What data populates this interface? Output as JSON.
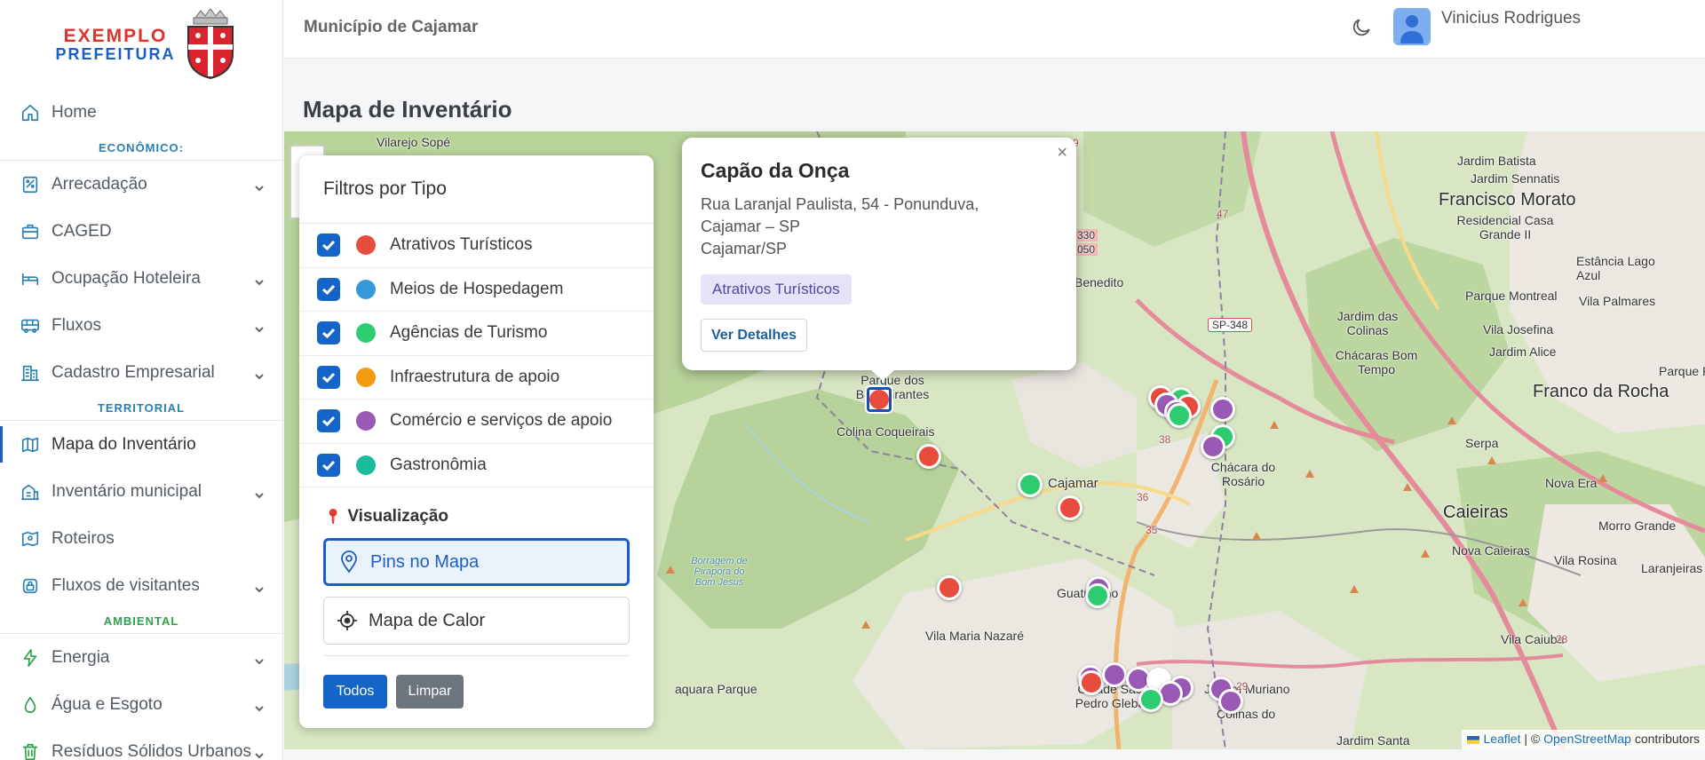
{
  "brand": {
    "line1": "EXEMPLO",
    "line2": "PREFEITURA"
  },
  "sidebar": {
    "home": "Home",
    "sections": {
      "economico": "ECONÔMICO:",
      "territorial": "TERRITORIAL",
      "ambiental": "AMBIENTAL"
    },
    "economico_items": [
      {
        "label": "Arrecadação",
        "icon": "receipt-icon",
        "has_chevron": true
      },
      {
        "label": "CAGED",
        "icon": "briefcase-icon",
        "has_chevron": false
      },
      {
        "label": "Ocupação Hoteleira",
        "icon": "bed-icon",
        "has_chevron": true
      },
      {
        "label": "Fluxos",
        "icon": "bus-icon",
        "has_chevron": true
      },
      {
        "label": "Cadastro Empresarial",
        "icon": "building-icon",
        "has_chevron": true
      }
    ],
    "territorial_items": [
      {
        "label": "Mapa do Inventário",
        "icon": "map-icon",
        "has_chevron": false,
        "active": true
      },
      {
        "label": "Inventário municipal",
        "icon": "city-icon",
        "has_chevron": true
      },
      {
        "label": "Roteiros",
        "icon": "route-icon",
        "has_chevron": false
      },
      {
        "label": "Fluxos de visitantes",
        "icon": "lock-icon",
        "has_chevron": true
      }
    ],
    "ambiental_items": [
      {
        "label": "Energia",
        "icon": "lightning-icon",
        "has_chevron": true
      },
      {
        "label": "Água e Esgoto",
        "icon": "drop-icon",
        "has_chevron": true
      },
      {
        "label": "Resíduos Sólidos Urbanos",
        "icon": "trash-icon",
        "has_chevron": true
      }
    ]
  },
  "header": {
    "title": "Município de Cajamar",
    "user_name": "Vinicius Rodrigues"
  },
  "page": {
    "title": "Mapa de Inventário"
  },
  "filters": {
    "title": "Filtros por Tipo",
    "types": [
      {
        "label": "Atrativos Turísticos",
        "color": "#e74c3c",
        "checked": true
      },
      {
        "label": "Meios de Hospedagem",
        "color": "#3498db",
        "checked": true
      },
      {
        "label": "Agências de Turismo",
        "color": "#2ecc71",
        "checked": true
      },
      {
        "label": "Infraestrutura de apoio",
        "color": "#f39c12",
        "checked": true
      },
      {
        "label": "Comércio e serviços de apoio",
        "color": "#9b59b6",
        "checked": true
      },
      {
        "label": "Gastronômia",
        "color": "#1abc9c",
        "checked": true
      }
    ],
    "visualization_title": "Visualização",
    "pins_label": "Pins no Mapa",
    "heat_label": "Mapa de Calor",
    "all_label": "Todos",
    "clear_label": "Limpar",
    "colors": {
      "primary": "#1565c9",
      "secondary": "#6c757d"
    }
  },
  "popup": {
    "title": "Capão da Onça",
    "address_line1": "Rua Laranjal Paulista, 54 - Ponunduva,",
    "address_line2": "Cajamar – SP",
    "address_line3": "Cajamar/SP",
    "badge": "Atrativos Turísticos",
    "button": "Ver Detalhes",
    "close": "×"
  },
  "map": {
    "labels": [
      "Vilarejo Sopé",
      "Jardim Batista",
      "Jardim Sennatis",
      "Francisco Morato",
      "Residencial Casa Grande II",
      "Estância Lago Azul",
      "Parque Montreal",
      "Vila Palmares",
      "Jardim das Colinas",
      "Vila Josefina",
      "Jardim Alice",
      "Chácaras Bom Tempo",
      "Franco da Rocha",
      "Parque Pretór",
      "Parque dos Bandeirantes",
      "Colina Coqueirais",
      "Chácara do Rosário",
      "Serpa",
      "Nova Era",
      "Caieiras",
      "Morro Grande",
      "Nova Caieiras",
      "Vila Rosina",
      "Laranjeiras",
      "Vila Caiuba",
      "Vila Maria Nazaré",
      "Cidade São Pedro Gleba",
      "Jardim Muriano",
      "Colinas do",
      "Jardim Santa",
      "Borragem de Pirapora do Bom Jesus",
      "Benedito",
      "Guaturinho",
      "Cajamar",
      "aquara Parque"
    ],
    "road_labels": [
      "SP-348",
      "330",
      "050",
      "47",
      "38",
      "36",
      "35",
      "29",
      "28",
      "9"
    ],
    "attribution": {
      "leaflet": "Leaflet",
      "sep": "| ©",
      "osm": "OpenStreetMap",
      "suffix": "contributors"
    }
  }
}
